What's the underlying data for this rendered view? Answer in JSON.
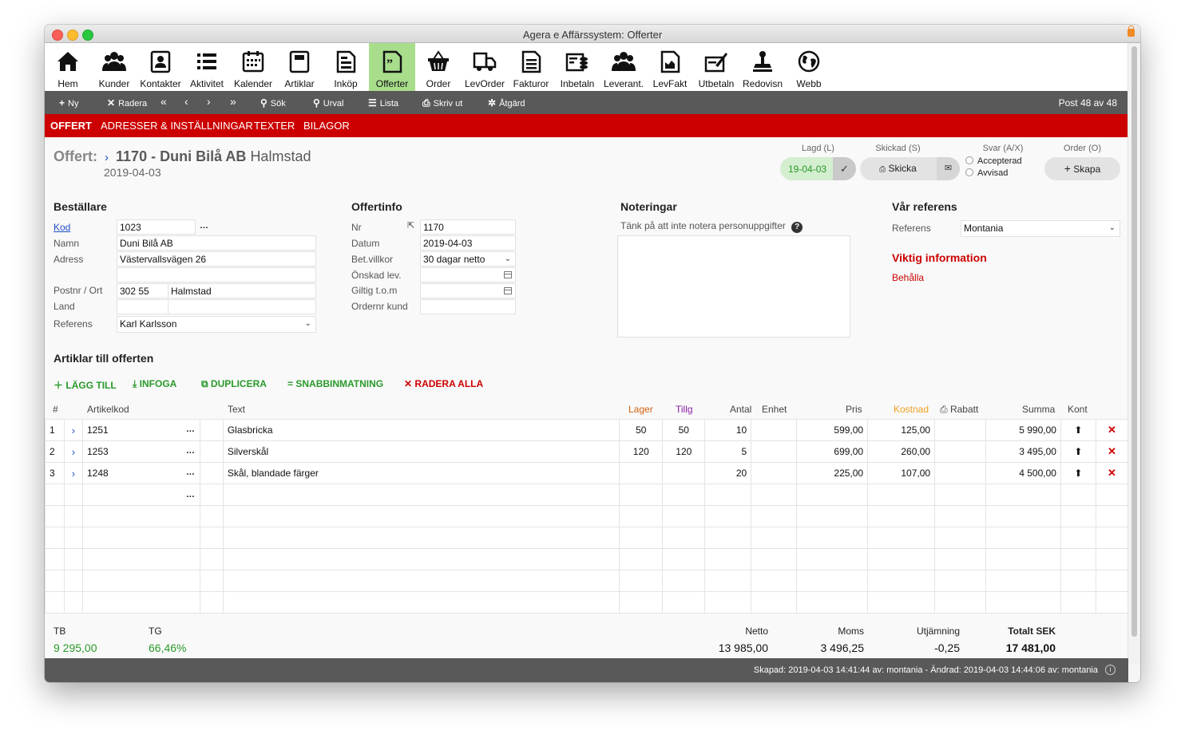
{
  "window": {
    "title": "Agera e Affärssystem: Offerter"
  },
  "toolbar": [
    {
      "label": "Hem",
      "icon": "home-icon"
    },
    {
      "label": "Kunder",
      "icon": "customers-icon"
    },
    {
      "label": "Kontakter",
      "icon": "contacts-icon"
    },
    {
      "label": "Aktivitet",
      "icon": "activity-icon"
    },
    {
      "label": "Kalender",
      "icon": "calendar-icon"
    },
    {
      "label": "Artiklar",
      "icon": "articles-icon"
    },
    {
      "label": "Inköp",
      "icon": "purchase-icon"
    },
    {
      "label": "Offerter",
      "icon": "quotes-icon"
    },
    {
      "label": "Order",
      "icon": "basket-icon"
    },
    {
      "label": "LevOrder",
      "icon": "truck-icon"
    },
    {
      "label": "Fakturor",
      "icon": "invoice-icon"
    },
    {
      "label": "Inbetaln",
      "icon": "payments-in-icon"
    },
    {
      "label": "Leverant.",
      "icon": "suppliers-icon"
    },
    {
      "label": "LevFakt",
      "icon": "supplier-invoice-icon"
    },
    {
      "label": "Utbetaln",
      "icon": "payments-out-icon"
    },
    {
      "label": "Redovisn",
      "icon": "stamp-icon"
    },
    {
      "label": "Webb",
      "icon": "globe-icon"
    }
  ],
  "actions": {
    "new": "Ny",
    "delete": "Radera",
    "search": "Sök",
    "filter": "Urval",
    "list": "Lista",
    "print": "Skriv ut",
    "action": "Åtgärd",
    "post": "Post 48 av 48"
  },
  "tabs": [
    "OFFERT",
    "ADRESSER & INSTÄLLNINGAR",
    "TEXTER",
    "BILAGOR"
  ],
  "header": {
    "prefix": "Offert:",
    "number_customer": "1170 - Duni Bilå AB",
    "city": "Halmstad",
    "date": "2019-04-03"
  },
  "status": {
    "lagd_label": "Lagd (L)",
    "lagd_value": "19-04-03",
    "skickad_label": "Skickad (S)",
    "skicka_button": "Skicka",
    "svar_label": "Svar (A/X)",
    "accepted": "Accepterad",
    "rejected": "Avvisad",
    "order_label": "Order (O)",
    "skapa_button": "Skapa"
  },
  "bestallare": {
    "title": "Beställare",
    "kod_label": "Kod",
    "kod": "1023",
    "namn_label": "Namn",
    "namn": "Duni Bilå AB",
    "adress_label": "Adress",
    "adress": "Västervallsvägen 26",
    "postnr_label": "Postnr / Ort",
    "postnr": "302 55",
    "ort": "Halmstad",
    "land_label": "Land",
    "referens_label": "Referens",
    "referens": "Karl Karlsson"
  },
  "offertinfo": {
    "title": "Offertinfo",
    "nr_label": "Nr",
    "nr": "1170",
    "datum_label": "Datum",
    "datum": "2019-04-03",
    "betvillkor_label": "Bet.villkor",
    "betvillkor": "30 dagar netto",
    "onskad_label": "Önskad lev.",
    "giltig_label": "Giltig t.o.m",
    "ordernr_label": "Ordernr kund"
  },
  "noteringar": {
    "title": "Noteringar",
    "hint": "Tänk på att inte notera personuppgifter"
  },
  "var_referens": {
    "title": "Vår referens",
    "referens_label": "Referens",
    "referens": "Montania",
    "viktig_title": "Viktig information",
    "behalla": "Behålla"
  },
  "articles": {
    "title": "Artiklar till offerten",
    "add": "LÄGG TILL",
    "insert": "INFOGA",
    "duplicate": "DUPLICERA",
    "quick": "SNABBINMATNING",
    "delete_all": "RADERA ALLA",
    "columns": {
      "num": "#",
      "code": "Artikelkod",
      "text": "Text",
      "stock": "Lager",
      "avail": "Tillg",
      "qty": "Antal",
      "unit": "Enhet",
      "price": "Pris",
      "cost": "Kostnad",
      "discount": "Rabatt",
      "sum": "Summa",
      "account": "Kont"
    },
    "rows": [
      {
        "n": "1",
        "code": "1251",
        "text": "Glasbricka",
        "stock": "50",
        "avail": "50",
        "qty": "10",
        "price": "599,00",
        "cost": "125,00",
        "sum": "5 990,00"
      },
      {
        "n": "2",
        "code": "1253",
        "text": "Silverskål",
        "stock": "120",
        "avail": "120",
        "qty": "5",
        "price": "699,00",
        "cost": "260,00",
        "sum": "3 495,00"
      },
      {
        "n": "3",
        "code": "1248",
        "text": "Skål, blandade färger",
        "stock": "",
        "avail": "",
        "qty": "20",
        "price": "225,00",
        "cost": "107,00",
        "sum": "4 500,00"
      }
    ]
  },
  "totals": {
    "tb_label": "TB",
    "tb": "9 295,00",
    "tg_label": "TG",
    "tg": "66,46%",
    "netto_label": "Netto",
    "netto": "13 985,00",
    "moms_label": "Moms",
    "moms": "3 496,25",
    "utj_label": "Utjämning",
    "utj": "-0,25",
    "total_label": "Totalt SEK",
    "total": "17 481,00"
  },
  "footer": {
    "text": "Skapad: 2019-04-03 14:41:44 av: montania - Ändrad: 2019-04-03 14:44:06 av: montania"
  },
  "colors": {
    "accent_red": "#cc0000",
    "active_green": "#a8dd8c",
    "bar_gray": "#595959",
    "total_green": "#2a9a2a"
  }
}
